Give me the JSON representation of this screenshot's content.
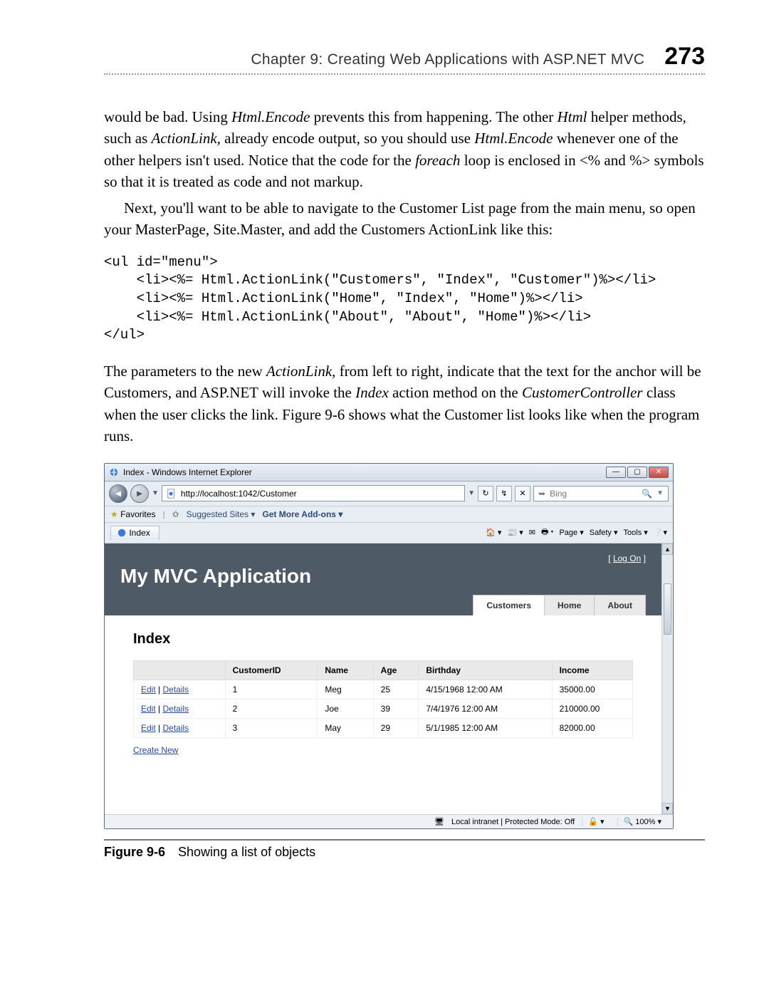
{
  "header": {
    "chapter_line": "Chapter 9:   Creating Web Applications with ASP.NET MVC",
    "page_number": "273"
  },
  "paragraphs": {
    "p1_a": "would be bad. Using ",
    "p1_b": "Html.Encode",
    "p1_c": " prevents this from happening. The other ",
    "p1_d": "Html",
    "p1_e": " helper methods, such as ",
    "p1_f": "ActionLink,",
    "p1_g": " already encode output, so you should use ",
    "p1_h": "Html.Encode",
    "p1_i": " whenever one of the other helpers isn't used. Notice that the code for the ",
    "p1_j": "foreach",
    "p1_k": " loop is enclosed in <% and %> symbols so that it is treated as code and not markup.",
    "p2": "Next, you'll want to be able to navigate to the Customer List page from the main menu, so open your MasterPage, Site.Master, and add the Customers ActionLink like this:",
    "p3_a": "The parameters to the new ",
    "p3_b": "ActionLink,",
    "p3_c": " from left to right, indicate that the text for the anchor will be Customers, and ASP.NET will invoke the ",
    "p3_d": "Index",
    "p3_e": " action method on the ",
    "p3_f": "CustomerController",
    "p3_g": " class when the user clicks the link. Figure 9-6 shows what the Customer list looks like when the program runs."
  },
  "code_block": "<ul id=\"menu\">\n    <li><%= Html.ActionLink(\"Customers\", \"Index\", \"Customer\")%></li>\n    <li><%= Html.ActionLink(\"Home\", \"Index\", \"Home\")%></li>\n    <li><%= Html.ActionLink(\"About\", \"About\", \"Home\")%></li>\n</ul>",
  "browser": {
    "window_title": "Index - Windows Internet Explorer",
    "url": "http://localhost:1042/Customer",
    "search_placeholder": "Bing",
    "favorites_label": "Favorites",
    "suggested": "Suggested Sites ▾",
    "addons": "Get More Add-ons ▾",
    "tab_label": "Index",
    "tools": {
      "page": "Page ▾",
      "safety": "Safety ▾",
      "tools": "Tools ▾"
    },
    "status": {
      "zone": "Local intranet | Protected Mode: Off",
      "zoom": "100%"
    }
  },
  "app": {
    "logon": "Log On",
    "title": "My MVC Application",
    "tabs": {
      "customers": "Customers",
      "home": "Home",
      "about": "About"
    },
    "page_heading": "Index",
    "columns": {
      "actions": "",
      "id": "CustomerID",
      "name": "Name",
      "age": "Age",
      "birthday": "Birthday",
      "income": "Income"
    },
    "action_labels": {
      "edit": "Edit",
      "details": "Details"
    },
    "rows": [
      {
        "id": "1",
        "name": "Meg",
        "age": "25",
        "birthday": "4/15/1968 12:00 AM",
        "income": "35000.00"
      },
      {
        "id": "2",
        "name": "Joe",
        "age": "39",
        "birthday": "7/4/1976 12:00 AM",
        "income": "210000.00"
      },
      {
        "id": "3",
        "name": "May",
        "age": "29",
        "birthday": "5/1/1985 12:00 AM",
        "income": "82000.00"
      }
    ],
    "create_new": "Create New"
  },
  "figure": {
    "label": "Figure 9-6",
    "caption": "Showing a list of objects"
  }
}
